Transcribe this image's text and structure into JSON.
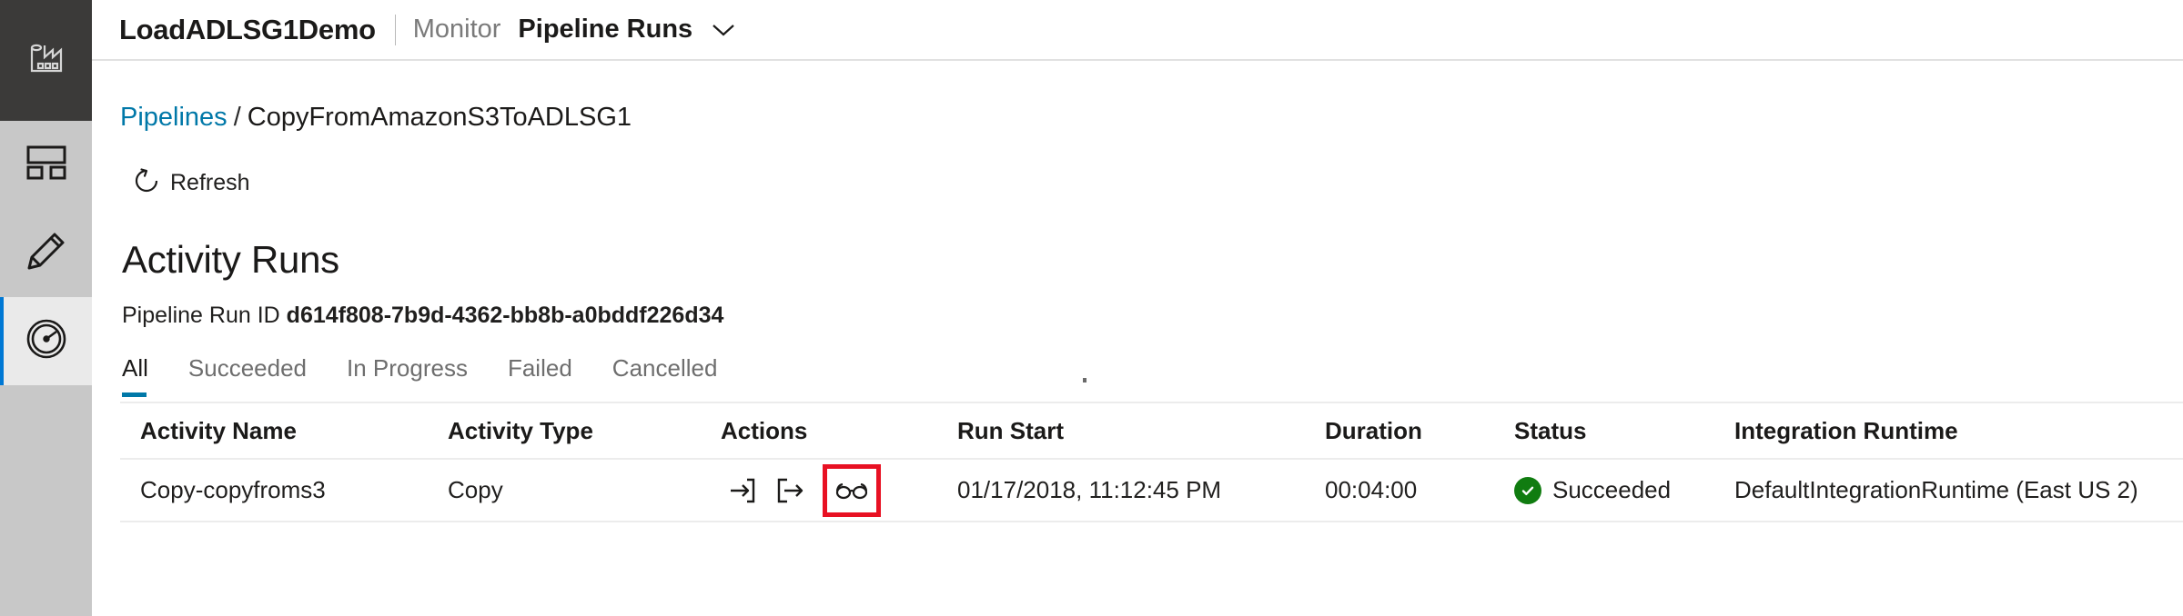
{
  "sidebar": {
    "items": [
      {
        "name": "factory-logo",
        "icon": "factory-icon",
        "active": false
      },
      {
        "name": "home",
        "icon": "dashboard-icon",
        "active": false
      },
      {
        "name": "author",
        "icon": "pencil-icon",
        "active": false
      },
      {
        "name": "monitor",
        "icon": "gauge-icon",
        "active": true
      }
    ]
  },
  "topbar": {
    "factory_name": "LoadADLSG1Demo",
    "section": "Monitor",
    "page": "Pipeline Runs",
    "page_chevron": "chevron-down-icon"
  },
  "breadcrumb": {
    "root": "Pipelines",
    "separator": "/",
    "current": "CopyFromAmazonS3ToADLSG1"
  },
  "toolbar": {
    "refresh_label": "Refresh",
    "refresh_icon": "refresh-icon"
  },
  "section": {
    "title": "Activity Runs",
    "run_id_label": "Pipeline Run ID",
    "run_id_value": "d614f808-7b9d-4362-bb8b-a0bddf226d34"
  },
  "tabs": [
    {
      "label": "All",
      "active": true
    },
    {
      "label": "Succeeded",
      "active": false
    },
    {
      "label": "In Progress",
      "active": false
    },
    {
      "label": "Failed",
      "active": false
    },
    {
      "label": "Cancelled",
      "active": false
    }
  ],
  "table": {
    "columns": [
      "Activity Name",
      "Activity Type",
      "Actions",
      "Run Start",
      "Duration",
      "Status",
      "Integration Runtime"
    ],
    "rows": [
      {
        "activity_name": "Copy-copyfroms3",
        "activity_type": "Copy",
        "actions": [
          {
            "name": "input-icon",
            "highlighted": false
          },
          {
            "name": "output-icon",
            "highlighted": false
          },
          {
            "name": "details-glasses-icon",
            "highlighted": true
          }
        ],
        "run_start": "01/17/2018, 11:12:45 PM",
        "duration": "00:04:00",
        "status": "Succeeded",
        "status_icon": "success-check-icon",
        "integration_runtime": "DefaultIntegrationRuntime (East US 2)"
      }
    ]
  },
  "colors": {
    "accent_blue": "#0078d4",
    "link_blue": "#0078a8",
    "success_green": "#107c10",
    "highlight_red": "#e81123",
    "rail_gray": "#c8c8c8",
    "logo_dark": "#3b3a39"
  }
}
